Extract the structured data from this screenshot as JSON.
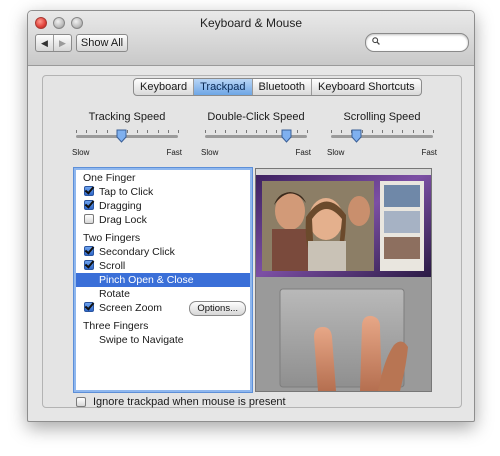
{
  "window": {
    "title": "Keyboard & Mouse"
  },
  "toolbar": {
    "back_glyph": "◀",
    "forward_glyph": "▶",
    "show_all_label": "Show All",
    "search_placeholder": ""
  },
  "tabs": [
    {
      "label": "Keyboard",
      "active": false
    },
    {
      "label": "Trackpad",
      "active": true
    },
    {
      "label": "Bluetooth",
      "active": false
    },
    {
      "label": "Keyboard Shortcuts",
      "active": false
    }
  ],
  "sliders": [
    {
      "label": "Tracking Speed",
      "min_label": "Slow",
      "max_label": "Fast",
      "value": 0.45
    },
    {
      "label": "Double-Click Speed",
      "min_label": "Slow",
      "max_label": "Fast",
      "value": 0.8
    },
    {
      "label": "Scrolling Speed",
      "min_label": "Slow",
      "max_label": "Fast",
      "value": 0.25
    }
  ],
  "gestures": {
    "group_one": "One Finger",
    "tap_to_click": "Tap to Click",
    "dragging": "Dragging",
    "drag_lock": "Drag Lock",
    "group_two": "Two Fingers",
    "secondary_click": "Secondary Click",
    "scroll": "Scroll",
    "pinch": "Pinch Open & Close",
    "rotate": "Rotate",
    "screen_zoom": "Screen Zoom",
    "options_label": "Options...",
    "group_three": "Three Fingers",
    "swipe": "Swipe to Navigate"
  },
  "checked": {
    "tap_to_click": true,
    "dragging": true,
    "drag_lock": false,
    "secondary_click": true,
    "scroll": true,
    "screen_zoom": true
  },
  "ignore_label": "Ignore trackpad when mouse is present",
  "colors": {
    "accent": "#3a6fd8",
    "tab_active": "#6ea6e6"
  },
  "icons": {
    "search": "search-icon",
    "back": "back-arrow-icon",
    "forward": "forward-arrow-icon"
  }
}
